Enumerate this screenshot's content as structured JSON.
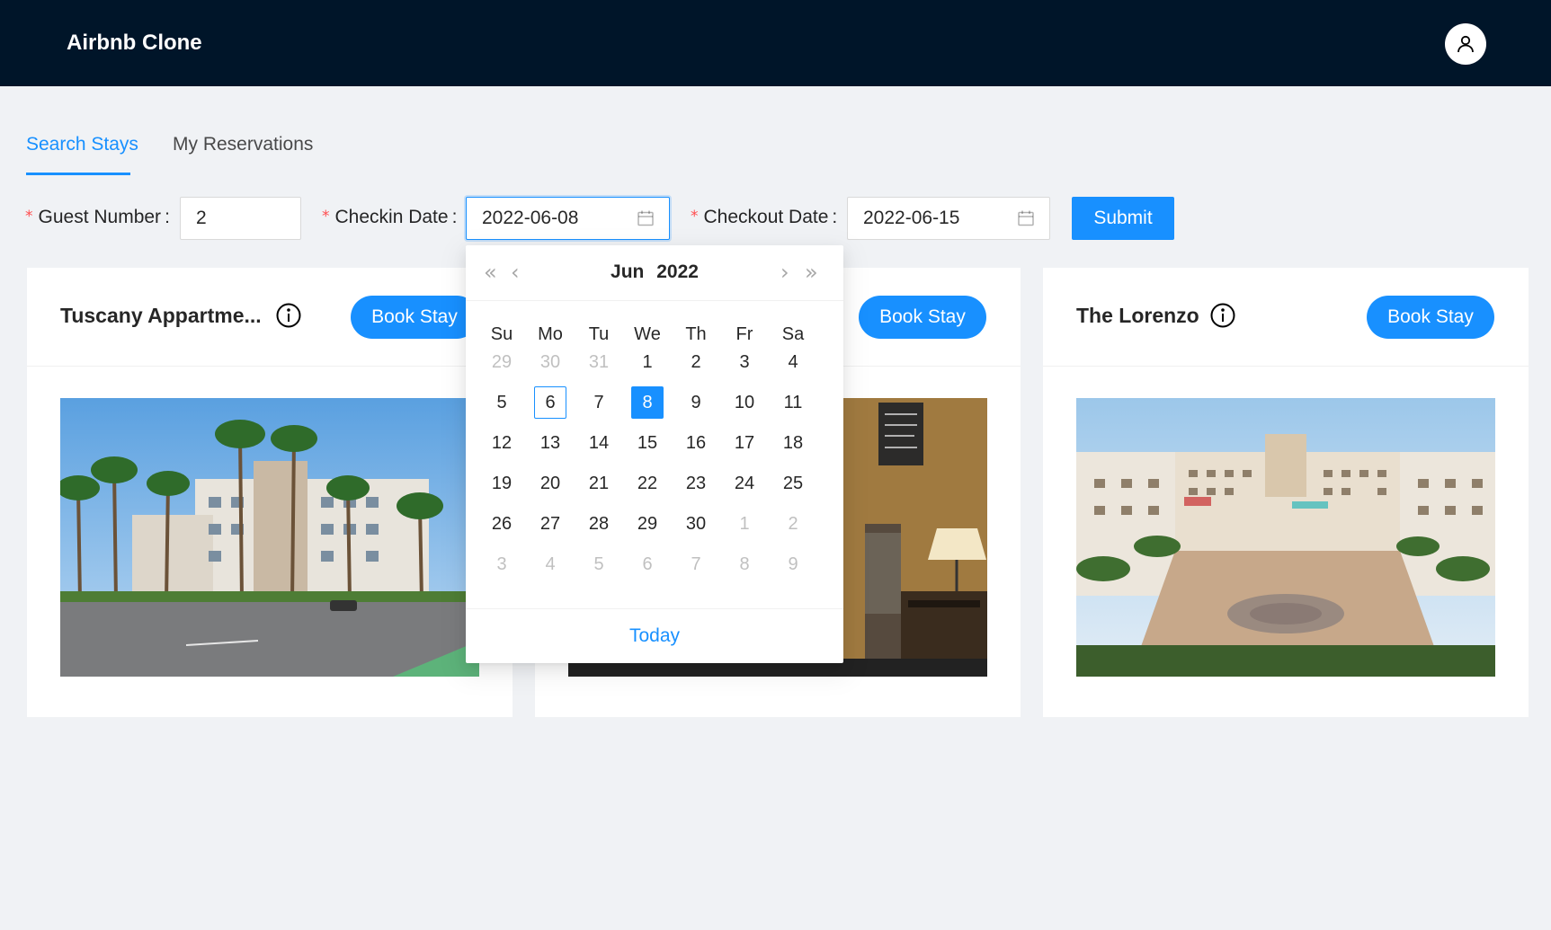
{
  "header": {
    "logo": "Airbnb Clone"
  },
  "tabs": [
    {
      "label": "Search Stays",
      "active": true
    },
    {
      "label": "My Reservations",
      "active": false
    }
  ],
  "form": {
    "guest_label": "Guest Number",
    "guest_value": "2",
    "checkin_label": "Checkin Date",
    "checkin_value": "2022-06-08",
    "checkout_label": "Checkout Date",
    "checkout_value": "2022-06-15",
    "submit_label": "Submit",
    "required_mark": "*",
    "colon": ":"
  },
  "cards": [
    {
      "title": "Tuscany Appartme...",
      "button": "Book Stay"
    },
    {
      "title": "",
      "button": "Book Stay"
    },
    {
      "title": "The Lorenzo",
      "button": "Book Stay"
    }
  ],
  "datepicker": {
    "month": "Jun",
    "year": "2022",
    "weekdays": [
      "Su",
      "Mo",
      "Tu",
      "We",
      "Th",
      "Fr",
      "Sa"
    ],
    "weeks": [
      [
        "29",
        "30",
        "31",
        "1",
        "2",
        "3",
        "4"
      ],
      [
        "5",
        "6",
        "7",
        "8",
        "9",
        "10",
        "11"
      ],
      [
        "12",
        "13",
        "14",
        "15",
        "16",
        "17",
        "18"
      ],
      [
        "19",
        "20",
        "21",
        "22",
        "23",
        "24",
        "25"
      ],
      [
        "26",
        "27",
        "28",
        "29",
        "30",
        "1",
        "2"
      ],
      [
        "3",
        "4",
        "5",
        "6",
        "7",
        "8",
        "9"
      ]
    ],
    "today_date": "6",
    "selected_date": "8",
    "today_label": "Today"
  },
  "colors": {
    "primary": "#1890ff",
    "header_bg": "#001529",
    "page_bg": "#f0f2f5",
    "required": "#ff4d4f"
  },
  "icons": [
    "user-icon",
    "calendar-icon",
    "info-icon",
    "double-left-icon",
    "left-icon",
    "right-icon",
    "double-right-icon"
  ]
}
